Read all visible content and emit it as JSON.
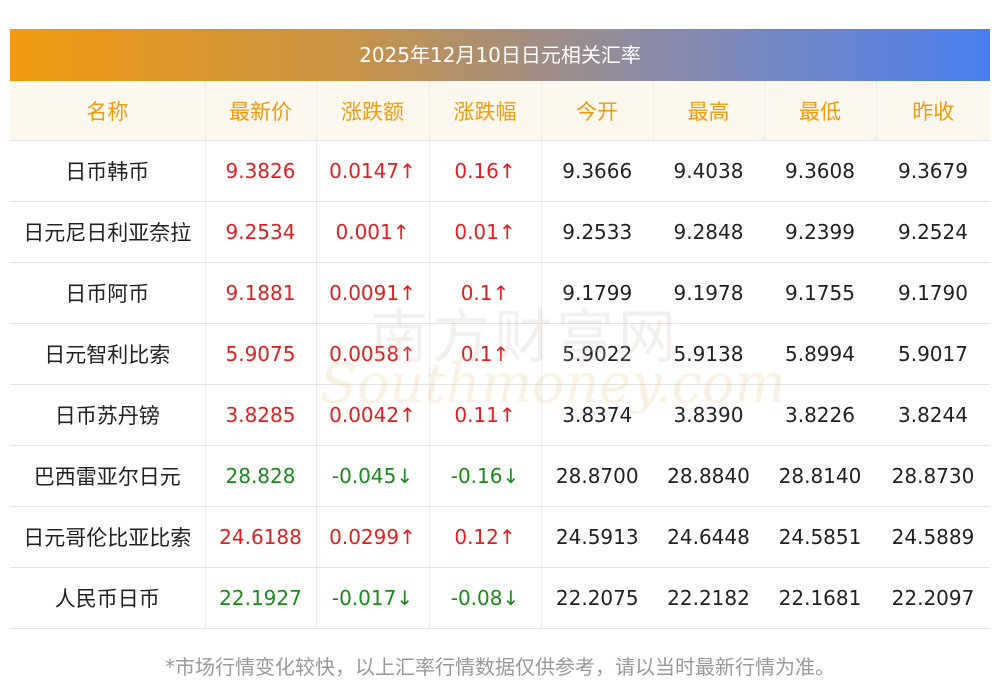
{
  "title": "2025年12月10日日元相关汇率",
  "headers": [
    "名称",
    "最新价",
    "涨跌额",
    "涨跌幅",
    "今开",
    "最高",
    "最低",
    "昨收"
  ],
  "rows": [
    {
      "name": "日币韩币",
      "latest": "9.3826",
      "change": "0.0147↑",
      "pct": "0.16↑",
      "open": "9.3666",
      "high": "9.4038",
      "low": "9.3608",
      "prev": "9.3679",
      "dir": "up"
    },
    {
      "name": "日元尼日利亚奈拉",
      "latest": "9.2534",
      "change": "0.001↑",
      "pct": "0.01↑",
      "open": "9.2533",
      "high": "9.2848",
      "low": "9.2399",
      "prev": "9.2524",
      "dir": "up"
    },
    {
      "name": "日币阿币",
      "latest": "9.1881",
      "change": "0.0091↑",
      "pct": "0.1↑",
      "open": "9.1799",
      "high": "9.1978",
      "low": "9.1755",
      "prev": "9.1790",
      "dir": "up"
    },
    {
      "name": "日元智利比索",
      "latest": "5.9075",
      "change": "0.0058↑",
      "pct": "0.1↑",
      "open": "5.9022",
      "high": "5.9138",
      "low": "5.8994",
      "prev": "5.9017",
      "dir": "up"
    },
    {
      "name": "日币苏丹镑",
      "latest": "3.8285",
      "change": "0.0042↑",
      "pct": "0.11↑",
      "open": "3.8374",
      "high": "3.8390",
      "low": "3.8226",
      "prev": "3.8244",
      "dir": "up"
    },
    {
      "name": "巴西雷亚尔日元",
      "latest": "28.828",
      "change": "-0.045↓",
      "pct": "-0.16↓",
      "open": "28.8700",
      "high": "28.8840",
      "low": "28.8140",
      "prev": "28.8730",
      "dir": "down"
    },
    {
      "name": "日元哥伦比亚比索",
      "latest": "24.6188",
      "change": "0.0299↑",
      "pct": "0.12↑",
      "open": "24.5913",
      "high": "24.6448",
      "low": "24.5851",
      "prev": "24.5889",
      "dir": "up"
    },
    {
      "name": "人民币日币",
      "latest": "22.1927",
      "change": "-0.017↓",
      "pct": "-0.08↓",
      "open": "22.2075",
      "high": "22.2182",
      "low": "22.1681",
      "prev": "22.2097",
      "dir": "down"
    }
  ],
  "watermark": {
    "cn": "南方财富网",
    "en": "Southmoney.com"
  },
  "note": "*市场行情变化较快，以上汇率行情数据仅供参考，请以当时最新行情为准。",
  "colors": {
    "up": "#e02020",
    "down": "#1a8a1a",
    "header_text": "#f29a0f",
    "header_bg": "#fdf8ee"
  }
}
